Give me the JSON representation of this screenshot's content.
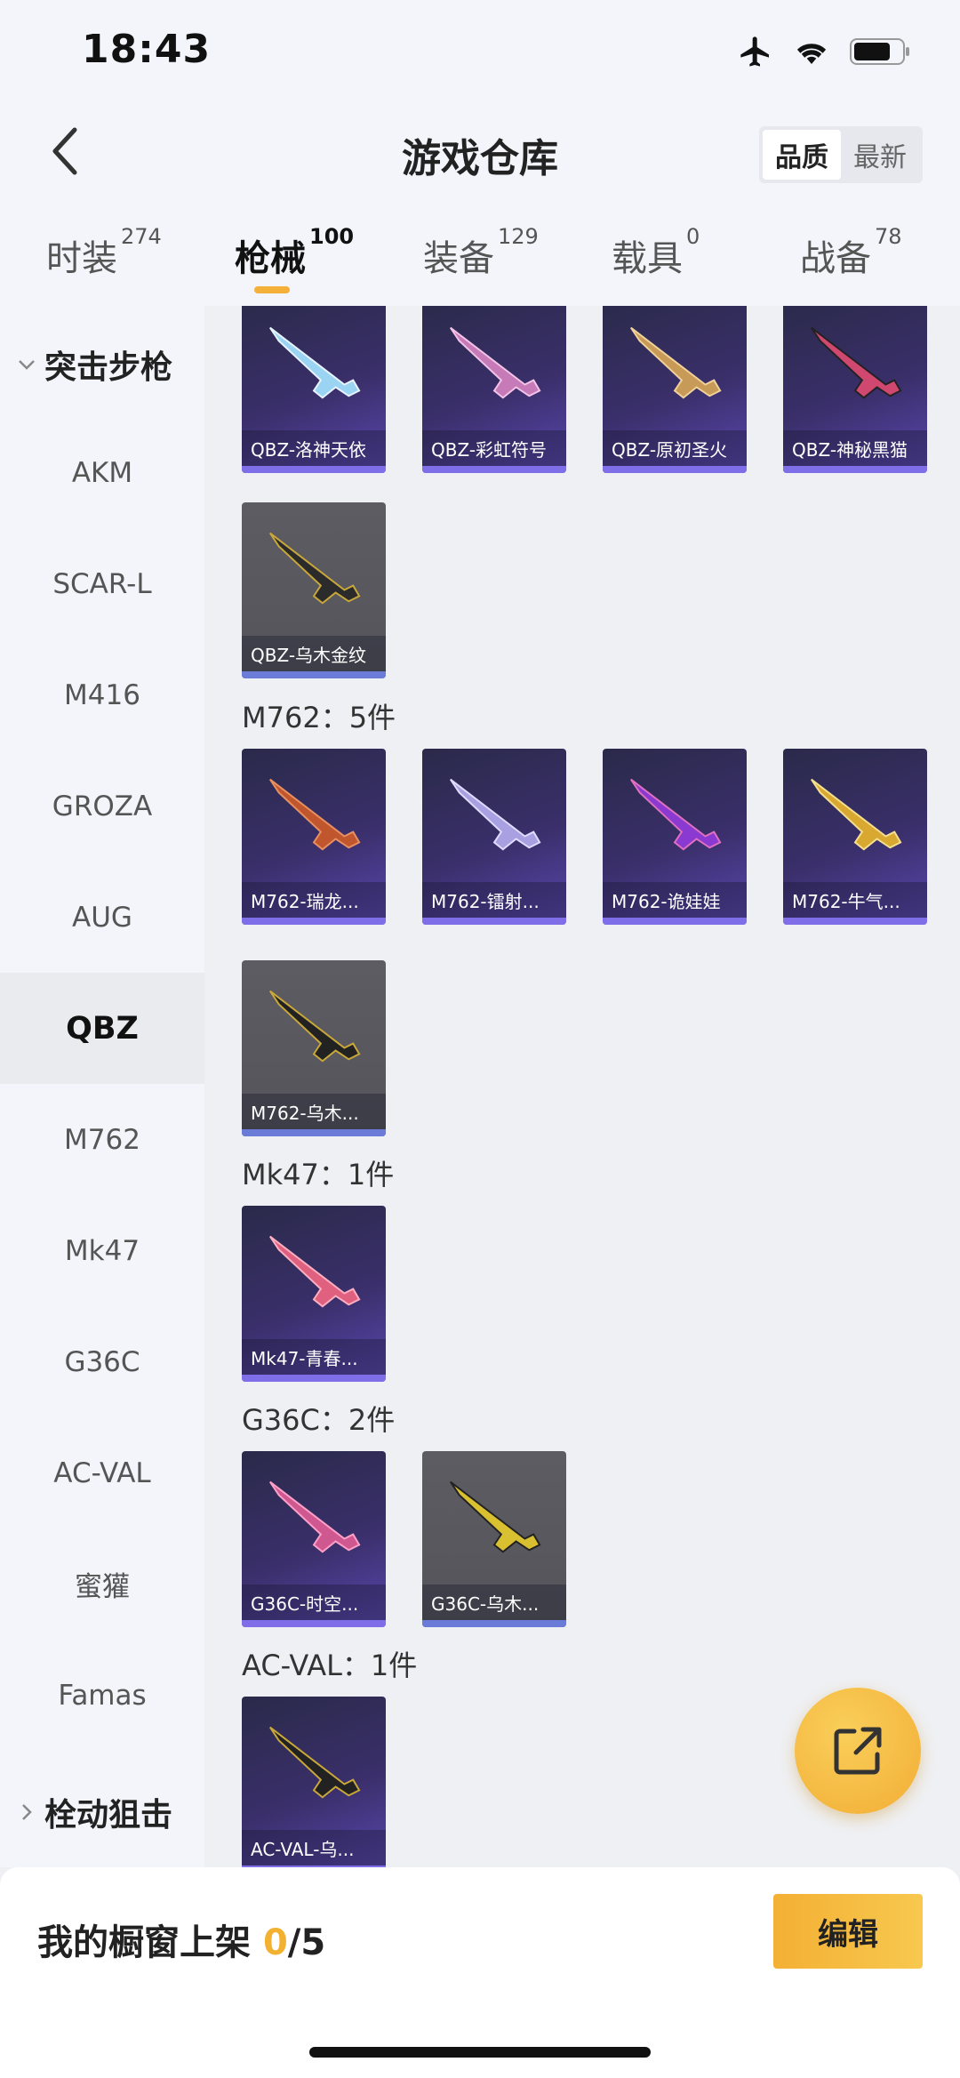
{
  "status": {
    "time": "18:43"
  },
  "nav": {
    "title": "游戏仓库",
    "sort": [
      "品质",
      "最新"
    ]
  },
  "tabs": [
    {
      "label": "时装",
      "count": "274"
    },
    {
      "label": "枪械",
      "count": "100"
    },
    {
      "label": "装备",
      "count": "129"
    },
    {
      "label": "载具",
      "count": "0"
    },
    {
      "label": "战备",
      "count": "78"
    }
  ],
  "sidebar": {
    "group_open": "突击步枪",
    "items": [
      "AKM",
      "SCAR-L",
      "M416",
      "GROZA",
      "AUG",
      "QBZ",
      "M762",
      "Mk47",
      "G36C",
      "AC-VAL",
      "蜜獾",
      "Famas"
    ],
    "group_closed": "栓动狙击"
  },
  "content": {
    "qbz": [
      "QBZ-洛神天依",
      "QBZ-彩虹符号",
      "QBZ-原初圣火",
      "QBZ-神秘黑猫",
      "QBZ-乌木金纹"
    ],
    "m762_title": "M762：5件",
    "m762": [
      "M762-瑞龙...",
      "M762-镭射...",
      "M762-诡娃娃",
      "M762-牛气...",
      "M762-乌木..."
    ],
    "mk47_title": "Mk47：1件",
    "mk47": [
      "Mk47-青春..."
    ],
    "g36c_title": "G36C：2件",
    "g36c": [
      "G36C-时空...",
      "G36C-乌木..."
    ],
    "acval_title": "AC-VAL：1件",
    "acval": [
      "AC-VAL-乌..."
    ]
  },
  "bottom": {
    "label": "我的橱窗上架 ",
    "count": "0",
    "total": "/5",
    "edit": "编辑"
  }
}
